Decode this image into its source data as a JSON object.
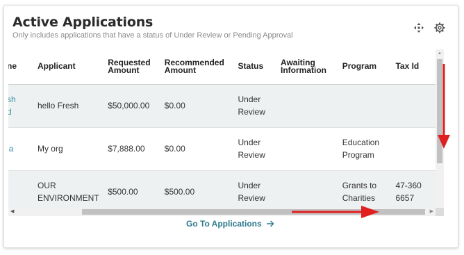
{
  "header": {
    "title": "Active Applications",
    "subtitle": "Only includes applications that have a status of Under Review or Pending Approval",
    "icons": [
      "collapse-icon",
      "gear-icon"
    ]
  },
  "table": {
    "columns": [
      {
        "label": "ne"
      },
      {
        "label": "Applicant"
      },
      {
        "label": "Requested Amount"
      },
      {
        "label": "Recommended Amount"
      },
      {
        "label": "Status"
      },
      {
        "label": "Awaiting Information"
      },
      {
        "label": "Program"
      },
      {
        "label": "Tax Id"
      }
    ],
    "rows": [
      {
        "name": "sh d",
        "applicant": "hello Fresh",
        "requested": "$50,000.00",
        "recommended": "$0.00",
        "status": "Under Review",
        "awaiting": "",
        "program": "",
        "tax_id": ""
      },
      {
        "name": "ia",
        "applicant": "My org",
        "requested": "$7,888.00",
        "recommended": "$0.00",
        "status": "Under Review",
        "awaiting": "",
        "program": "Education Program",
        "tax_id": ""
      },
      {
        "name": "",
        "applicant": "OUR ENVIRONMENT",
        "requested": "$500.00",
        "recommended": "$500.00",
        "status": "Under Review",
        "awaiting": "",
        "program": "Grants to Charities",
        "tax_id": "47-3606657"
      }
    ]
  },
  "footer": {
    "link_label": "Go To Applications",
    "link_icon": "arrow-right-icon"
  },
  "colors": {
    "link": "#2e7a8c",
    "row_alt": "#eef1f1",
    "annotation": "#e02020"
  }
}
